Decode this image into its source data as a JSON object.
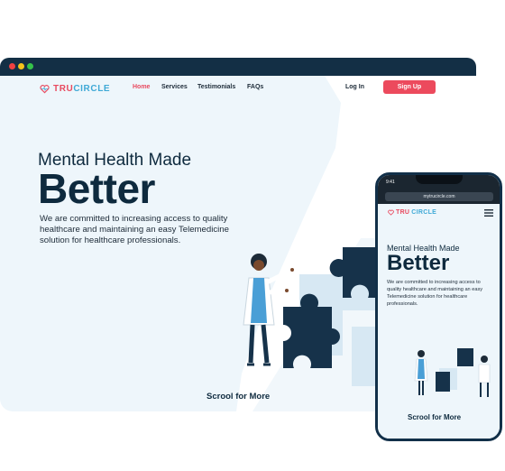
{
  "window": {
    "colors": {
      "bar": "#132f45",
      "close": "#ef4141",
      "minimize": "#f5c31b",
      "maximize": "#35c24a"
    }
  },
  "brand": {
    "tru": "TRU",
    "circle": "CIRCLE",
    "accent": "#e84a5f",
    "secondary": "#3fa9d6"
  },
  "nav": {
    "items": [
      "Home",
      "Services",
      "Testimonials",
      "FAQs"
    ],
    "active": "Home"
  },
  "auth": {
    "login": "Log In",
    "signup": "Sign Up"
  },
  "hero": {
    "subtitle": "Mental Health Made",
    "title": "Better",
    "description": "We are committed to increasing access to quality healthcare and maintaining an easy Telemedicine solution for healthcare professionals.",
    "scroll": "Scrool for More"
  },
  "phone": {
    "time": "9:41",
    "url": "mytrucircle.com",
    "subtitle": "Mental Health Made",
    "title": "Better",
    "description": "We are committed to increasing access to quality healthcare and maintaining an easy Telemedicine solution for healthcare professionals.",
    "scroll": "Scrool for More"
  },
  "icons": [
    "heart-logo-icon",
    "hamburger-menu-icon",
    "lock-icon",
    "reload-icon"
  ]
}
